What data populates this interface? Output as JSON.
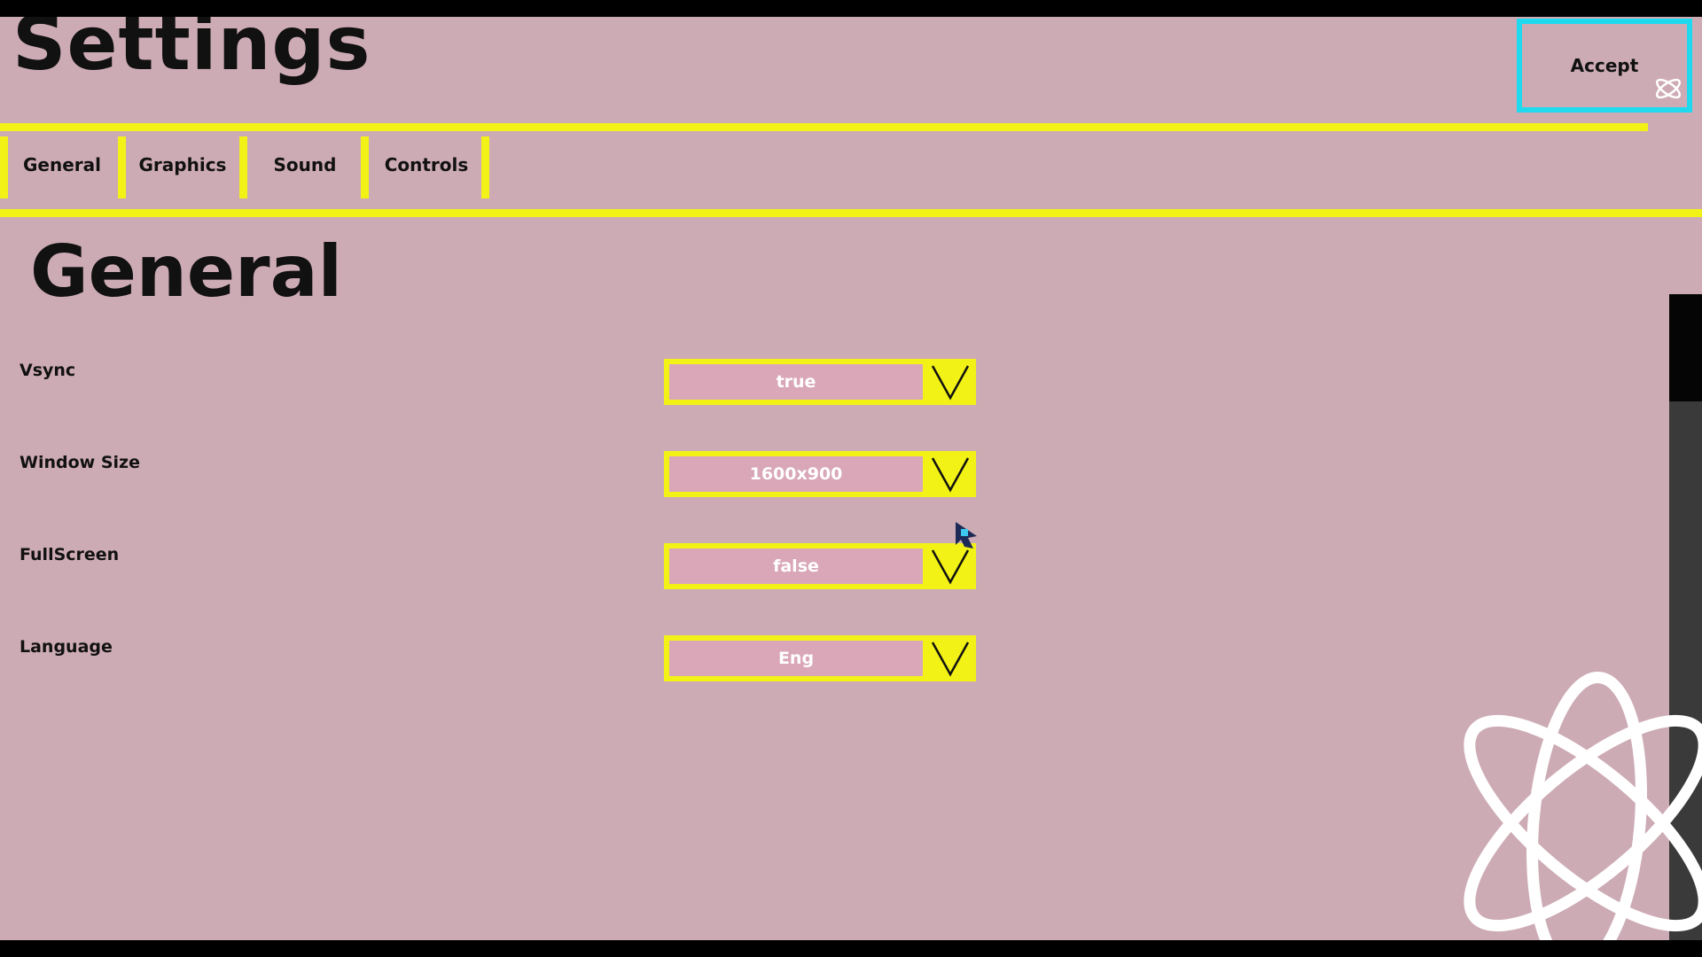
{
  "header": {
    "title": "Settings",
    "accept_label": "Accept"
  },
  "tabs": [
    {
      "label": "General"
    },
    {
      "label": "Graphics"
    },
    {
      "label": "Sound"
    },
    {
      "label": "Controls"
    }
  ],
  "section": {
    "heading": "General"
  },
  "settings": [
    {
      "label": "Vsync",
      "value": "true"
    },
    {
      "label": "Window Size",
      "value": "1600x900"
    },
    {
      "label": "FullScreen",
      "value": "false"
    },
    {
      "label": "Language",
      "value": "Eng"
    }
  ],
  "colors": {
    "background": "#cdabb5",
    "accent_yellow": "#f2f216",
    "accept_border": "#1fd9ef",
    "field_fill": "#d9a7b7"
  },
  "icons": [
    "chevron-down-icon",
    "atom-icon",
    "mouse-cursor-icon"
  ]
}
